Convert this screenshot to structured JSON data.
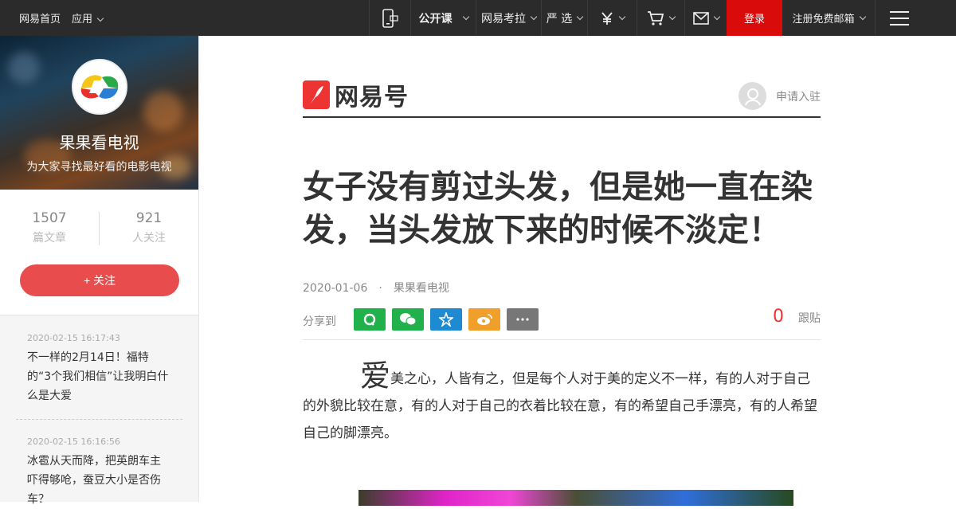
{
  "topbar": {
    "home": "网易首页",
    "apps": "应用",
    "open_course": "公开课",
    "kaola": "网易考拉",
    "yanxuan": "严 选",
    "login": "登录",
    "register_mail": "注册免费邮箱"
  },
  "profile": {
    "name": "果果看电视",
    "description": "为大家寻找最好看的电影电视",
    "articles_count": "1507",
    "articles_label": "篇文章",
    "followers_count": "921",
    "followers_label": "人关注",
    "follow_button": "+ 关注"
  },
  "related": [
    {
      "date": "2020-02-15 16:17:43",
      "title": "不一样的2月14日！福特的“3个我们相信”让我明白什么是大爱"
    },
    {
      "date": "2020-02-15 16:16:56",
      "title": "冰雹从天而降，把英朗车主吓得够呛，蚕豆大小是否伤车？"
    }
  ],
  "header": {
    "brand": "网易号",
    "apply": "申请入驻"
  },
  "article": {
    "title": "女子没有剪过头发，但是她一直在染发，当头发放下来的时候不淡定！",
    "date": "2020-01-06",
    "dot": "·",
    "source": "果果看电视",
    "share_label": "分享到",
    "comment_count": "0",
    "comment_label": "跟贴",
    "lead_char": "爱",
    "body": "美之心，人皆有之，但是每个人对于美的定义不一样，有的人对于自己的外貌比较在意，有的人对于自己的衣着比较在意，有的希望自己手漂亮，有的人希望自己的脚漂亮。"
  },
  "colors": {
    "topbar_bg": "#2b2b2b",
    "login_bg": "#d90b0b",
    "follow_bg": "#e84c4c",
    "share_qzone": "#21b14b",
    "share_wechat": "#21b14b",
    "share_friends": "#1e8ad2",
    "share_weibo": "#f0a02a",
    "share_more": "#777777",
    "comment_count": "#ee3333"
  },
  "icons": [
    "mobile-app-icon",
    "chevron-down-icon",
    "yen-icon",
    "cart-icon",
    "mail-icon",
    "menu-icon",
    "qzone-icon",
    "wechat-icon",
    "friends-star-icon",
    "weibo-icon",
    "more-icon",
    "user-avatar-icon"
  ]
}
